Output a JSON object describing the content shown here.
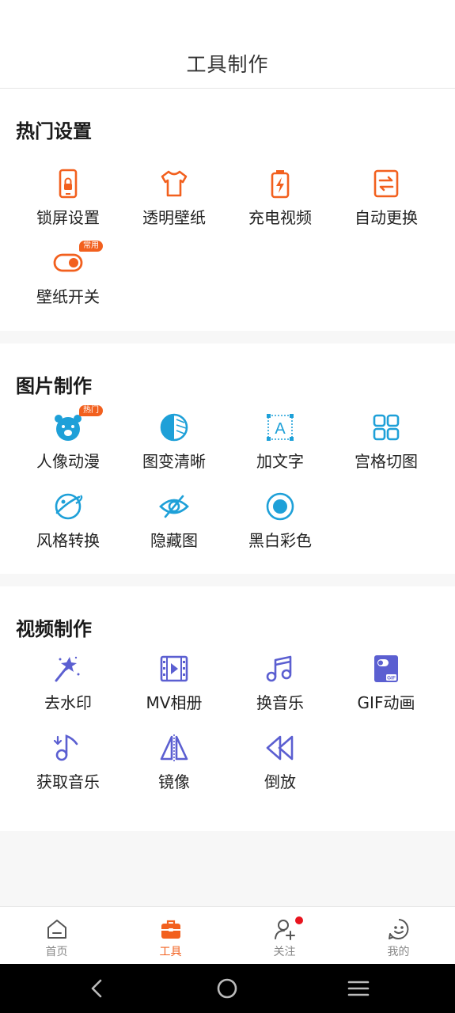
{
  "header": {
    "title": "工具制作"
  },
  "sections": [
    {
      "title": "热门设置",
      "items": [
        {
          "label": "锁屏设置",
          "icon": "phone-lock-icon"
        },
        {
          "label": "透明壁纸",
          "icon": "tshirt-icon"
        },
        {
          "label": "充电视频",
          "icon": "battery-charge-icon"
        },
        {
          "label": "自动更换",
          "icon": "swap-arrows-icon"
        },
        {
          "label": "壁纸开关",
          "icon": "toggle-switch-icon",
          "badge": "常用"
        }
      ]
    },
    {
      "title": "图片制作",
      "items": [
        {
          "label": "人像动漫",
          "icon": "bear-face-icon",
          "badge": "热门"
        },
        {
          "label": "图变清晰",
          "icon": "half-circle-icon"
        },
        {
          "label": "加文字",
          "icon": "text-box-icon"
        },
        {
          "label": "宫格切图",
          "icon": "grid-icon"
        },
        {
          "label": "风格转换",
          "icon": "planet-icon"
        },
        {
          "label": "隐藏图",
          "icon": "eye-off-icon"
        },
        {
          "label": "黑白彩色",
          "icon": "color-circle-icon"
        }
      ]
    },
    {
      "title": "视频制作",
      "items": [
        {
          "label": "去水印",
          "icon": "magic-wand-icon"
        },
        {
          "label": "MV相册",
          "icon": "film-icon"
        },
        {
          "label": "换音乐",
          "icon": "music-note-icon"
        },
        {
          "label": "GIF动画",
          "icon": "gif-file-icon"
        },
        {
          "label": "获取音乐",
          "icon": "music-download-icon"
        },
        {
          "label": "镜像",
          "icon": "mirror-icon"
        },
        {
          "label": "倒放",
          "icon": "rewind-icon"
        }
      ]
    }
  ],
  "tabbar": [
    {
      "label": "首页",
      "icon": "home-icon"
    },
    {
      "label": "工具",
      "icon": "toolbox-icon",
      "active": true
    },
    {
      "label": "关注",
      "icon": "add-user-icon",
      "has_notification": true
    },
    {
      "label": "我的",
      "icon": "smiley-face-icon"
    }
  ],
  "colors": {
    "orange": "#f2601e",
    "cyan": "#1ea0d8",
    "purple": "#5b5fd1",
    "notification": "#e8141e"
  }
}
